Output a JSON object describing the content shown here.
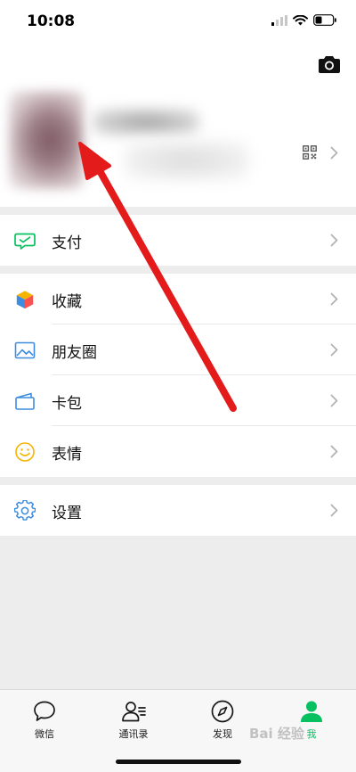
{
  "status_bar": {
    "time": "10:08"
  },
  "profile": {
    "camera_icon": "camera-icon",
    "qr_icon": "qrcode-icon"
  },
  "groups": {
    "pay": [
      {
        "label": "支付",
        "icon": "wechat-pay-icon",
        "color": "#07c160"
      }
    ],
    "main": [
      {
        "label": "收藏",
        "icon": "favorites-cube-icon"
      },
      {
        "label": "朋友圈",
        "icon": "moments-photo-icon",
        "color": "#3d8ce0"
      },
      {
        "label": "卡包",
        "icon": "card-wallet-icon",
        "color": "#3d8ce0"
      },
      {
        "label": "表情",
        "icon": "sticker-smiley-icon",
        "color": "#f5b400"
      }
    ],
    "settings": [
      {
        "label": "设置",
        "icon": "settings-gear-icon",
        "color": "#3d8ce0"
      }
    ]
  },
  "tabbar": {
    "tabs": [
      {
        "label": "微信",
        "icon": "chat-bubble-icon",
        "active": false
      },
      {
        "label": "通讯录",
        "icon": "contacts-icon",
        "active": false
      },
      {
        "label": "发现",
        "icon": "compass-icon",
        "active": false
      },
      {
        "label": "我",
        "icon": "person-icon",
        "active": true
      }
    ]
  },
  "watermark": "Bai 经验",
  "colors": {
    "accent": "#07c160",
    "annotation_arrow": "#e31b1b",
    "background": "#ededed"
  }
}
